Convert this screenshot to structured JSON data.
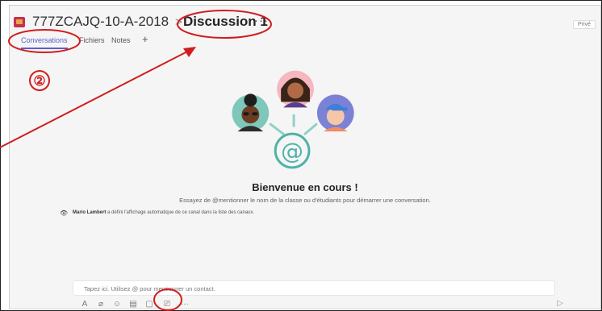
{
  "header": {
    "team_name": "777ZCAJQ-10-A-2018",
    "separator": ">",
    "channel_name": "Discussion 1",
    "channel_more": "···",
    "privacy_label": "Privé"
  },
  "tabs": [
    {
      "label": "Conversations",
      "active": true
    },
    {
      "label": "Fichiers",
      "active": false
    },
    {
      "label": "Notes",
      "active": false
    }
  ],
  "tab_add": "+",
  "annotation": {
    "step_number": "②",
    "color": "#d01d1d"
  },
  "welcome": {
    "title": "Bienvenue en cours !",
    "subtitle": "Essayez de @mentionner le nom de la classe ou d'étudiants pour démarrer une conversation."
  },
  "system_message": {
    "icon": "eye-icon",
    "actor": "Mario Lambert",
    "text": " a défini l'affichage automatique de ce canal dans la liste des canaux."
  },
  "composer": {
    "placeholder": "Tapez ici. Utilisez @ pour mentionner un contact.",
    "tools": [
      {
        "icon": "format-icon",
        "glyph": "A"
      },
      {
        "icon": "attach-icon",
        "glyph": "⌀"
      },
      {
        "icon": "emoji-icon",
        "glyph": "☺"
      },
      {
        "icon": "giphy-icon",
        "glyph": "▤"
      },
      {
        "icon": "sticker-icon",
        "glyph": "▢"
      },
      {
        "icon": "meet-now-icon",
        "glyph": "⎚"
      },
      {
        "icon": "more-icon",
        "glyph": "···"
      }
    ],
    "send_icon": "send-icon"
  },
  "colors": {
    "accent": "#5b5fc7",
    "background": "#f5f5f5",
    "annotation_red": "#d01d1d",
    "at_sign_teal": "#4fb3a9"
  }
}
